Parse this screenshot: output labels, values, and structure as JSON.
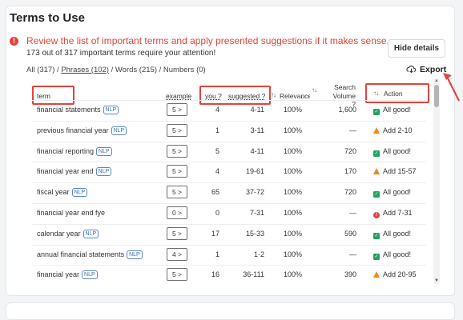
{
  "title": "Terms to Use",
  "alert": {
    "message": "Review the list of important terms and apply presented suggestions if it makes sense.",
    "sub": "173 out of 317 important terms require your attention!"
  },
  "hide_button": "Hide details",
  "filters": {
    "all": "All (317)",
    "sep1": " / ",
    "phrases": "Phrases (102)",
    "sep2": " / Words (215) / Numbers (0)"
  },
  "export_label": "Export",
  "columns": {
    "term": "term",
    "example": "example",
    "you": "you ?",
    "suggested": "suggested ?",
    "relevance": "Relevance",
    "search_volume_1": "Search",
    "search_volume_2": "Volume ?",
    "action": "Action"
  },
  "rows": [
    {
      "term": "financial statements",
      "nlp": "NLP",
      "example": "5 >",
      "you": "4",
      "suggested": "4-11",
      "relevance": "100%",
      "volume": "1,600",
      "status": "ok",
      "action": "All good!"
    },
    {
      "term": "previous financial year",
      "nlp": "NLP",
      "example": "5 >",
      "you": "1",
      "suggested": "3-11",
      "relevance": "100%",
      "volume": "—",
      "status": "warn",
      "action": "Add 2-10"
    },
    {
      "term": "financial reporting",
      "nlp": "NLP",
      "example": "5 >",
      "you": "5",
      "suggested": "4-11",
      "relevance": "100%",
      "volume": "720",
      "status": "ok",
      "action": "All good!"
    },
    {
      "term": "financial year end",
      "nlp": "NLP",
      "example": "5 >",
      "you": "4",
      "suggested": "19-61",
      "relevance": "100%",
      "volume": "170",
      "status": "warn",
      "action": "Add 15-57"
    },
    {
      "term": "fiscal year",
      "nlp": "NLP",
      "example": "5 >",
      "you": "65",
      "suggested": "37-72",
      "relevance": "100%",
      "volume": "720",
      "status": "ok",
      "action": "All good!"
    },
    {
      "term": "financial year end fye",
      "nlp": "",
      "example": "0 >",
      "you": "0",
      "suggested": "7-31",
      "relevance": "100%",
      "volume": "—",
      "status": "error",
      "action": "Add 7-31"
    },
    {
      "term": "calendar year",
      "nlp": "NLP",
      "example": "5 >",
      "you": "17",
      "suggested": "15-33",
      "relevance": "100%",
      "volume": "590",
      "status": "ok",
      "action": "All good!"
    },
    {
      "term": "annual financial statements",
      "nlp": "NLP",
      "example": "4 >",
      "you": "1",
      "suggested": "1-2",
      "relevance": "100%",
      "volume": "—",
      "status": "ok",
      "action": "All good!"
    },
    {
      "term": "financial year",
      "nlp": "NLP",
      "example": "5 >",
      "you": "16",
      "suggested": "36-111",
      "relevance": "100%",
      "volume": "390",
      "status": "warn",
      "action": "Add 20-95"
    }
  ],
  "colors": {
    "alert_red": "#e0443c",
    "ok_green": "#22a35a",
    "warn_orange": "#ea8a1a",
    "annotation_red": "#e0443c"
  }
}
